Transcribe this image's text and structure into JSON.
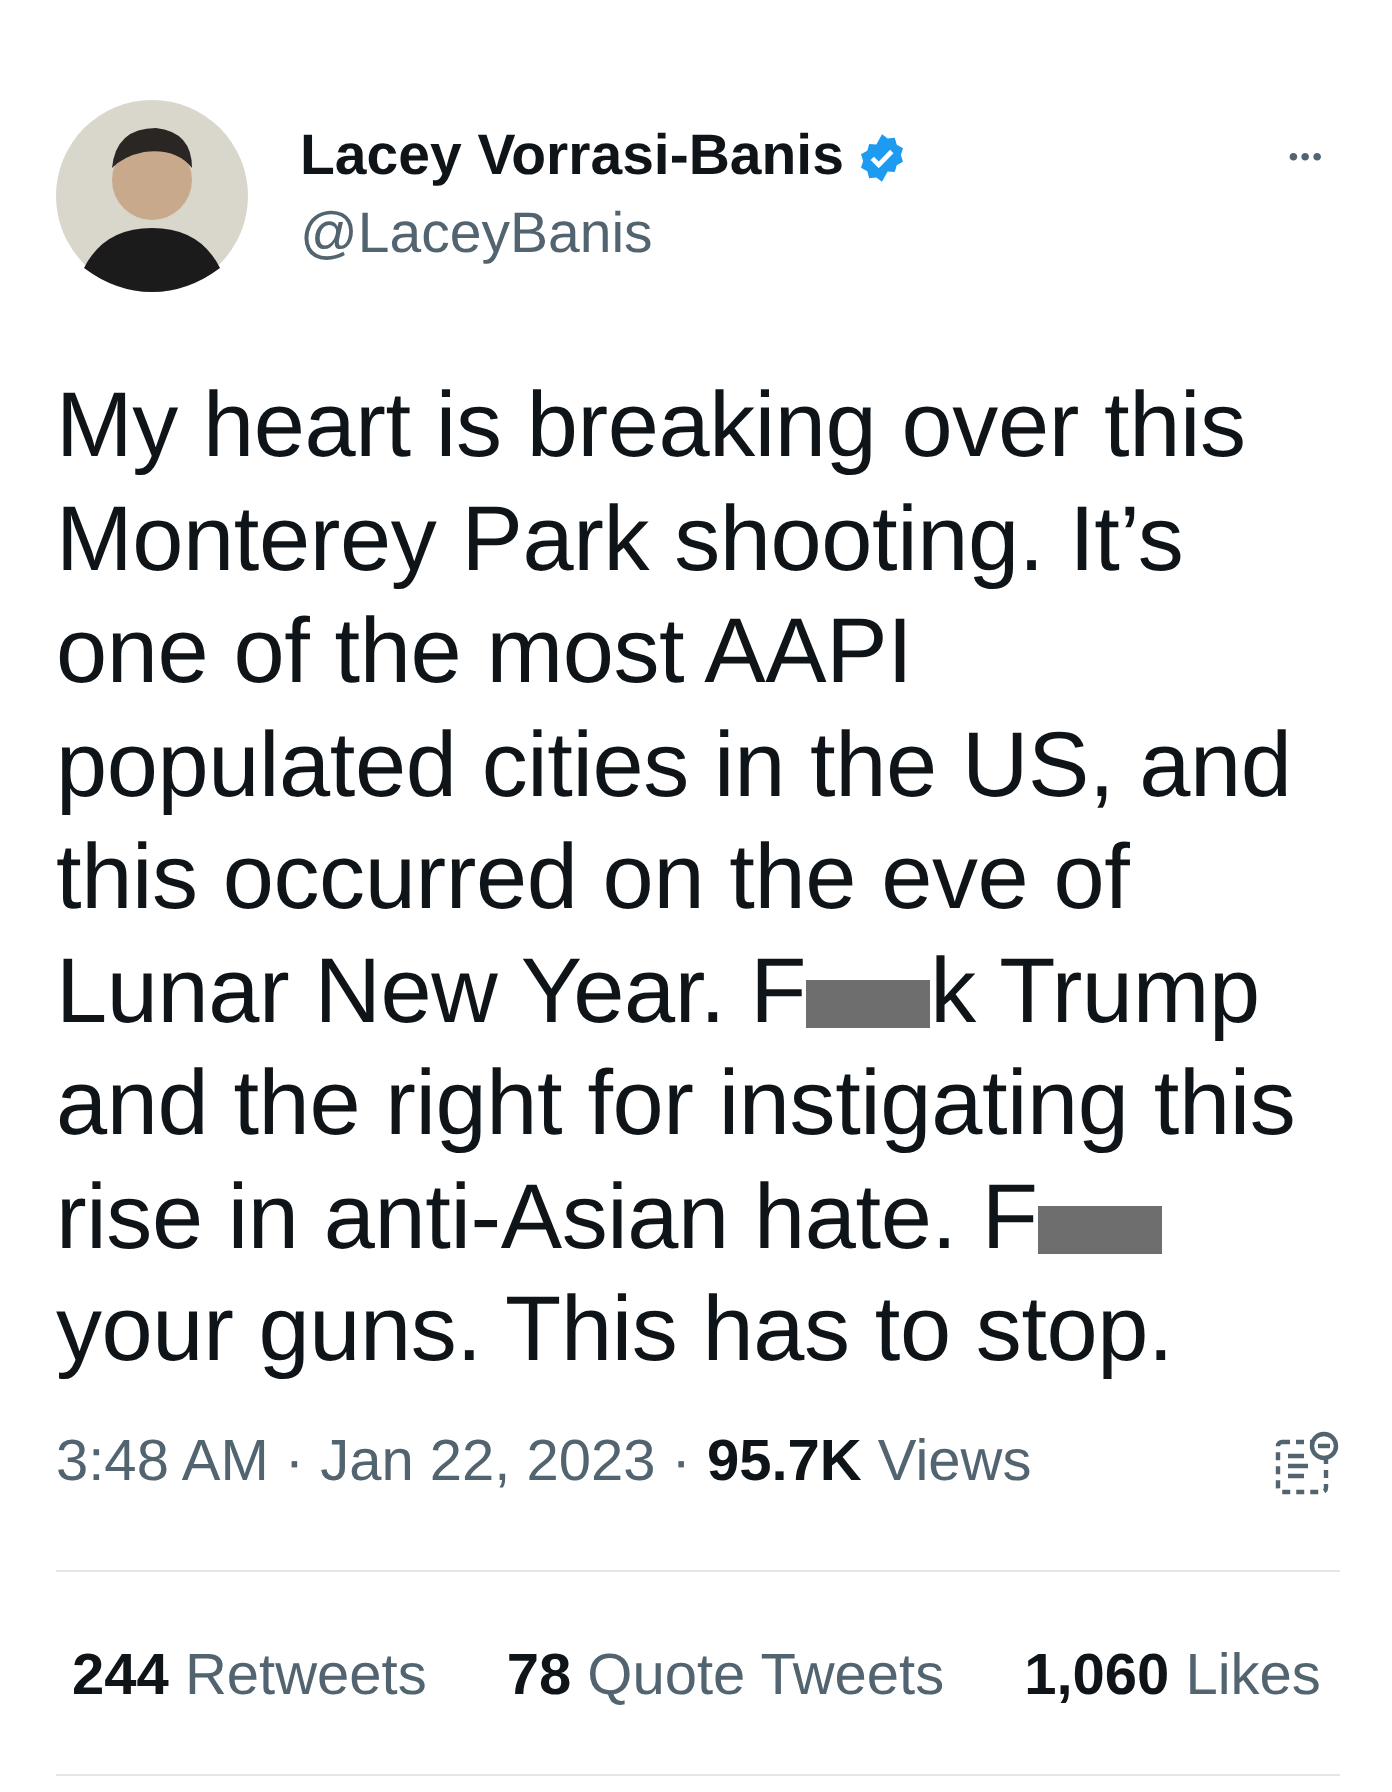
{
  "author": {
    "name": "Lacey Vorrasi-Banis",
    "verified": true,
    "handle": "@LaceyBanis"
  },
  "more_button": "•••",
  "text_lines": [
    [
      {
        "kind": "text",
        "text": "My heart is breaking over this"
      }
    ],
    [
      {
        "kind": "text",
        "text": "Monterey Park shooting. It’s"
      }
    ],
    [
      {
        "kind": "text",
        "text": "one of the most AAPI"
      }
    ],
    [
      {
        "kind": "text",
        "text": "populated cities in the US, and"
      }
    ],
    [
      {
        "kind": "text",
        "text": "this occurred on the eve of"
      }
    ],
    [
      {
        "kind": "text",
        "text": "Lunar New Year. F"
      },
      {
        "kind": "redaction"
      },
      {
        "kind": "text",
        "text": "k Trump"
      }
    ],
    [
      {
        "kind": "text",
        "text": "and the right for instigating this"
      }
    ],
    [
      {
        "kind": "text",
        "text": "rise in anti-Asian hate. F"
      },
      {
        "kind": "redaction"
      }
    ],
    [
      {
        "kind": "text",
        "text": "your guns. This has to stop."
      }
    ]
  ],
  "meta": {
    "separators": [
      "·",
      "·"
    ],
    "time": "3:48 AM",
    "date": "Jan 22, 2023",
    "views_count": "95.7K",
    "views_label": "Views"
  },
  "stats": [
    {
      "count": "244",
      "label": "Retweets"
    },
    {
      "count": "78",
      "label": "Quote Tweets"
    },
    {
      "count": "1,060",
      "label": "Likes"
    }
  ]
}
